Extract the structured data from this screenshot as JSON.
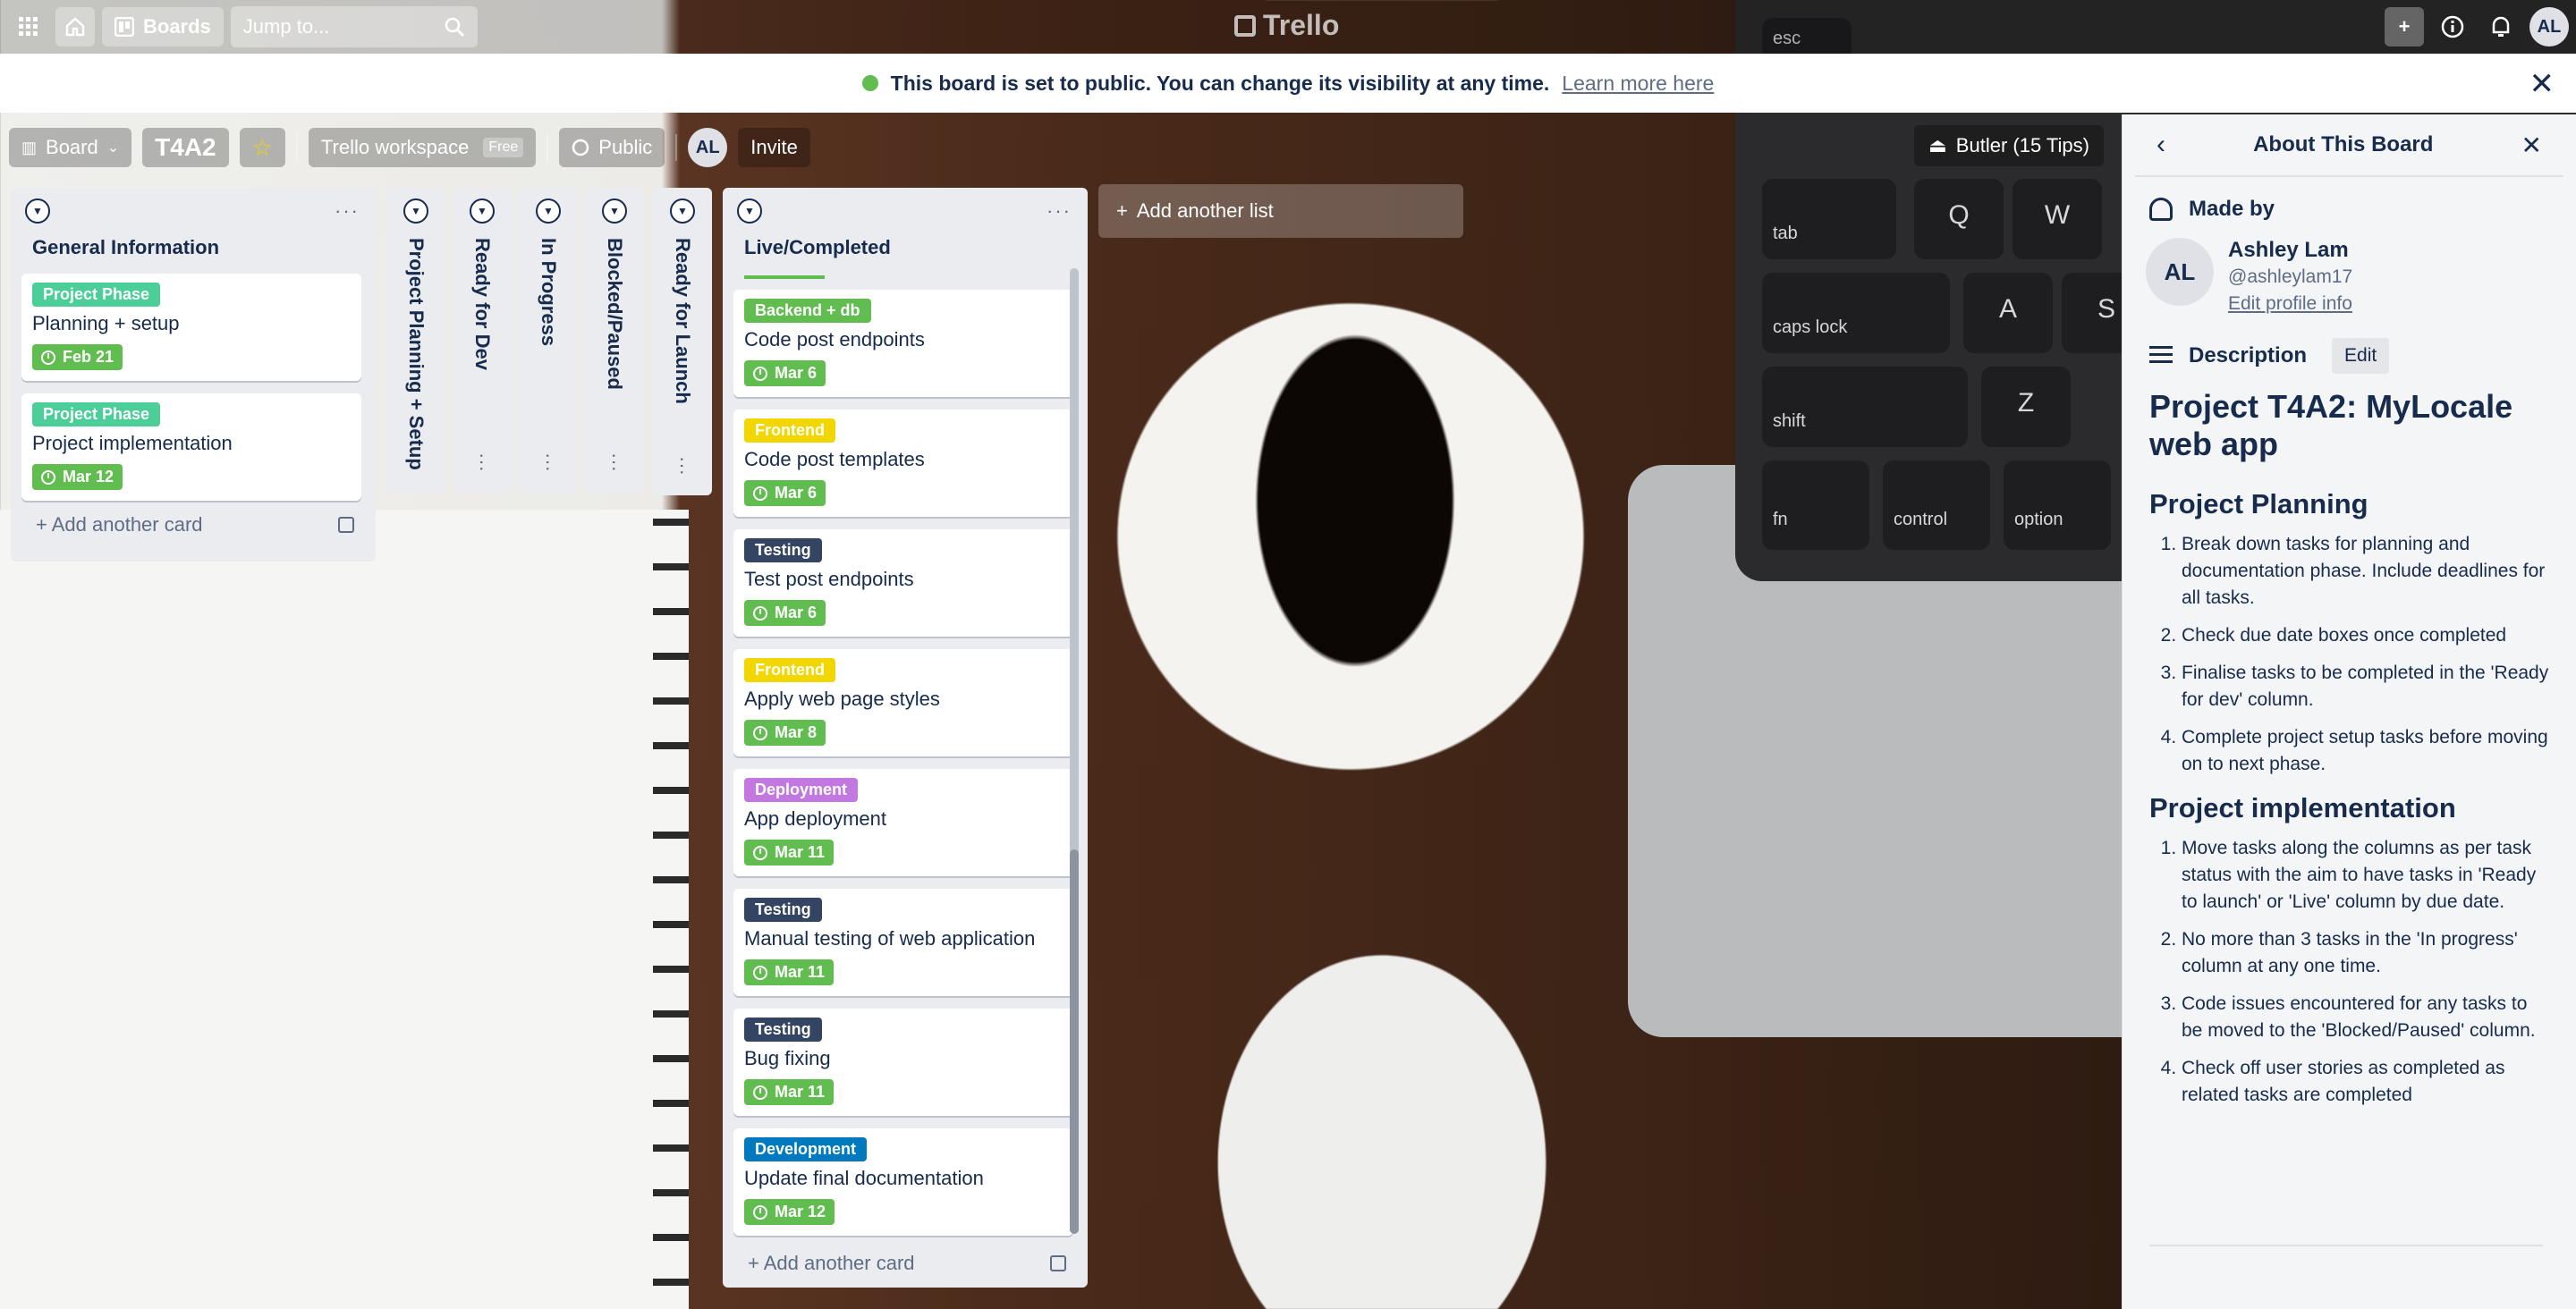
{
  "topbar": {
    "boards_label": "Boards",
    "search_placeholder": "Jump to...",
    "logo_text": "Trello",
    "avatar": "AL"
  },
  "banner": {
    "message": "This board is set to public. You can change its visibility at any time.",
    "link": "Learn more here"
  },
  "board_header": {
    "view": "Board",
    "title": "T4A2",
    "workspace": "Trello workspace",
    "workspace_badge": "Free",
    "visibility": "Public",
    "member_avatar": "AL",
    "invite": "Invite",
    "butler": "Butler (15 Tips)"
  },
  "lists": {
    "general": {
      "title": "General Information",
      "cards": [
        {
          "label": "Project Phase",
          "label_color": "#4bce97",
          "title": "Planning + setup",
          "due": "Feb 21"
        },
        {
          "label": "Project Phase",
          "label_color": "#4bce97",
          "title": "Project implementation",
          "due": "Mar 12"
        }
      ],
      "add_card": "Add another card"
    },
    "collapsed": [
      "Project Planning + Setup",
      "Ready for Dev",
      "In Progress",
      "Blocked/Paused",
      "Ready for Launch"
    ],
    "live": {
      "title": "Live/Completed",
      "cards": [
        {
          "label": "Backend + db",
          "label_color": "#61bd4f",
          "title": "Code post endpoints",
          "due": "Mar 6"
        },
        {
          "label": "Frontend",
          "label_color": "#f2d600",
          "title": "Code post templates",
          "due": "Mar 6"
        },
        {
          "label": "Testing",
          "label_color": "#344563",
          "title": "Test post endpoints",
          "due": "Mar 6"
        },
        {
          "label": "Frontend",
          "label_color": "#f2d600",
          "title": "Apply web page styles",
          "due": "Mar 8"
        },
        {
          "label": "Deployment",
          "label_color": "#c377e0",
          "title": "App deployment",
          "due": "Mar 11"
        },
        {
          "label": "Testing",
          "label_color": "#344563",
          "title": "Manual testing of web application",
          "due": "Mar 11"
        },
        {
          "label": "Testing",
          "label_color": "#344563",
          "title": "Bug fixing",
          "due": "Mar 11"
        },
        {
          "label": "Development",
          "label_color": "#0079bf",
          "title": "Update final documentation",
          "due": "Mar 12"
        }
      ],
      "add_card": "Add another card"
    },
    "add_list": "Add another list"
  },
  "sidebar": {
    "title": "About This Board",
    "made_by": "Made by",
    "avatar": "AL",
    "name": "Ashley Lam",
    "handle": "@ashleylam17",
    "edit_profile": "Edit profile info",
    "description": "Description",
    "edit": "Edit",
    "heading": "Project T4A2: MyLocale web app",
    "section1": "Project Planning",
    "section1_items": [
      "Break down tasks for planning and documentation phase. Include deadlines for all tasks.",
      "Check due date boxes once completed",
      "Finalise tasks to be completed in the 'Ready for dev' column.",
      "Complete project setup tasks before moving on to next phase."
    ],
    "section2": "Project implementation",
    "section2_items": [
      "Move tasks along the columns as per task status with the aim to have tasks in 'Ready to launch' or 'Live' column by due date.",
      "No more than 3 tasks in the 'In progress' column at any one time.",
      "Code issues encountered for any tasks to be moved to the 'Blocked/Paused' column.",
      "Check off user stories as completed as related tasks are completed"
    ]
  },
  "background_keys": [
    "esc",
    "tab",
    "caps lock",
    "shift",
    "fn",
    "control",
    "option",
    "Q",
    "W",
    "A",
    "S",
    "Z"
  ]
}
